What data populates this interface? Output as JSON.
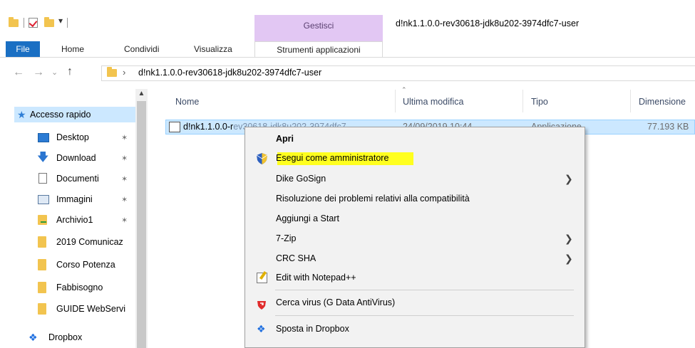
{
  "titlebar": {
    "gestisci": "Gestisci",
    "window_title": "d!nk1.1.0.0-rev30618-jdk8u202-3974dfc7-user"
  },
  "ribbon": {
    "tabs": [
      "File",
      "Home",
      "Condividi",
      "Visualizza"
    ],
    "context_tab": "Strumenti applicazioni"
  },
  "address": {
    "path": "d!nk1.1.0.0-rev30618-jdk8u202-3974dfc7-user"
  },
  "navpane": {
    "quick_access": "Accesso rapido",
    "items": [
      {
        "label": "Desktop",
        "icon": "desktop-icon"
      },
      {
        "label": "Download",
        "icon": "download-icon"
      },
      {
        "label": "Documenti",
        "icon": "documents-icon"
      },
      {
        "label": "Immagini",
        "icon": "pictures-icon"
      },
      {
        "label": "Archivio1",
        "icon": "network-folder-icon"
      },
      {
        "label": "2019 Comunicaz",
        "icon": "folder-icon"
      },
      {
        "label": "Corso Potenza",
        "icon": "folder-icon"
      },
      {
        "label": "Fabbisogno",
        "icon": "folder-icon"
      },
      {
        "label": "GUIDE WebServi",
        "icon": "folder-icon"
      }
    ],
    "dropbox": "Dropbox"
  },
  "columns": {
    "name": "Nome",
    "modified": "Ultima modifica",
    "type": "Tipo",
    "size": "Dimensione"
  },
  "file": {
    "name": "d!nk1.1.0.0-r",
    "name_hidden": "ev30618-jdk8u202-3974dfc7",
    "date": "24/09/2019 10:44",
    "type": "Applicazione",
    "size": "77.193 KB"
  },
  "menu": {
    "open": "Apri",
    "run_as_admin": "Esegui come amministratore",
    "dike": "Dike GoSign",
    "compat": "Risoluzione dei problemi relativi alla compatibilità",
    "add_start": "Aggiungi a Start",
    "zip": "7-Zip",
    "crc": "CRC SHA",
    "notepad": "Edit with Notepad++",
    "virus": "Cerca virus (G Data AntiVirus)",
    "dropbox": "Sposta in Dropbox"
  },
  "colors": {
    "highlight": "#ffff1f",
    "selection": "#cce8ff",
    "file_tab": "#1a6fc3",
    "gestisci_band": "#e2c7f3"
  }
}
